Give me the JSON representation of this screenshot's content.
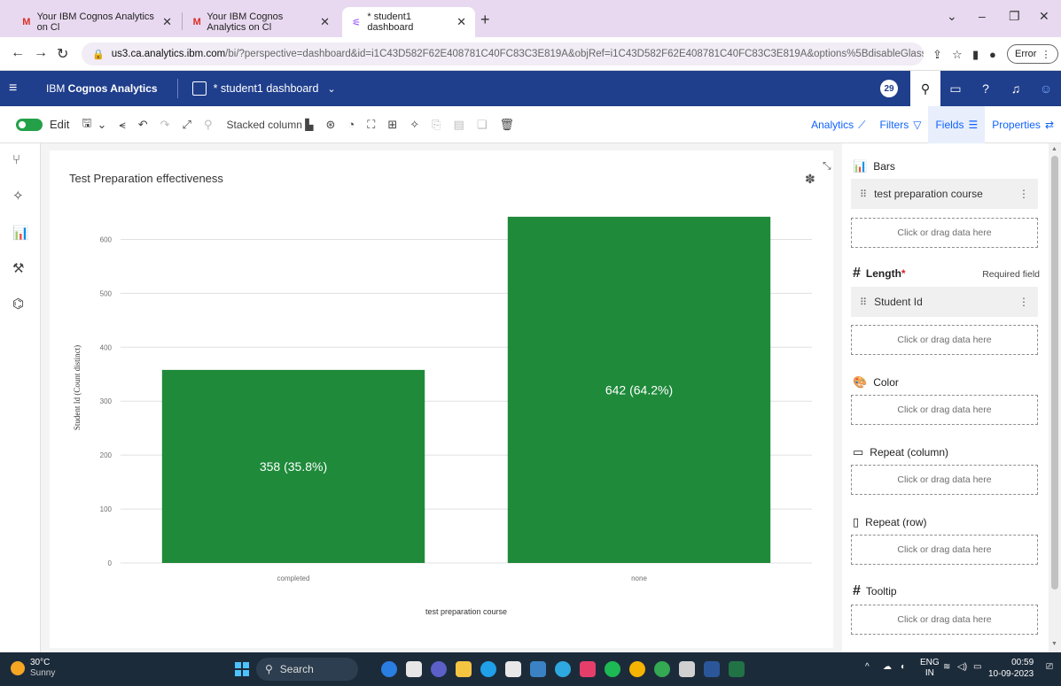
{
  "browser": {
    "tabs": [
      {
        "title": "Your IBM Cognos Analytics on Cl",
        "icon": "gmail-icon"
      },
      {
        "title": "Your IBM Cognos Analytics on Cl",
        "icon": "gmail-icon"
      },
      {
        "title": "* student1 dashboard",
        "icon": "cognos-icon"
      }
    ],
    "url_host": "us3.ca.analytics.ibm.com",
    "url_rest": "/bi/?perspective=dashboard&id=i1C43D582F62E408781C40FC83C3E819A&objRef=i1C43D582F62E408781C40FC83C3E819A&options%5BdisableGlassPrefetch%5D...",
    "error_label": "Error"
  },
  "app": {
    "brand_prefix": "IBM ",
    "brand_name": "Cognos Analytics",
    "dashboard_name": "* student1 dashboard",
    "notification_count": "29"
  },
  "toolbar": {
    "edit_label": "Edit",
    "chart_type_label": "Stacked column",
    "right_tabs": [
      {
        "label": "Analytics"
      },
      {
        "label": "Filters"
      },
      {
        "label": "Fields"
      },
      {
        "label": "Properties"
      }
    ]
  },
  "chart_data": {
    "type": "bar",
    "title": "Test Preparation effectiveness",
    "xlabel": "test preparation course",
    "ylabel": "Student Id (Count distinct)",
    "categories": [
      "completed",
      "none"
    ],
    "values": [
      358,
      642
    ],
    "data_labels": [
      "358 (35.8%)",
      "642 (64.2%)"
    ],
    "ylim": [
      0,
      650
    ],
    "yticks": [
      0,
      100,
      200,
      300,
      400,
      500,
      600
    ],
    "bar_color": "#1e8a3a",
    "grid": true
  },
  "fields_panel": {
    "bars": {
      "title": "Bars",
      "field": "test preparation course",
      "drop": "Click or drag data here"
    },
    "length": {
      "title": "Length",
      "required_mark": "*",
      "required_note": "Required field",
      "field": "Student Id",
      "drop": "Click or drag data here"
    },
    "color": {
      "title": "Color",
      "drop": "Click or drag data here"
    },
    "repeat_column": {
      "title": "Repeat (column)",
      "drop": "Click or drag data here"
    },
    "repeat_row": {
      "title": "Repeat (row)",
      "drop": "Click or drag data here"
    },
    "tooltip": {
      "title": "Tooltip",
      "drop": "Click or drag data here"
    }
  },
  "taskbar": {
    "temp": "30°C",
    "weather": "Sunny",
    "search_label": "Search",
    "lang_top": "ENG",
    "lang_bottom": "IN",
    "time": "00:59",
    "date": "10-09-2023"
  },
  "colors": {
    "header_bg": "#1f3e8c",
    "accent": "#0f62fe",
    "toggle_on": "#24a148"
  }
}
